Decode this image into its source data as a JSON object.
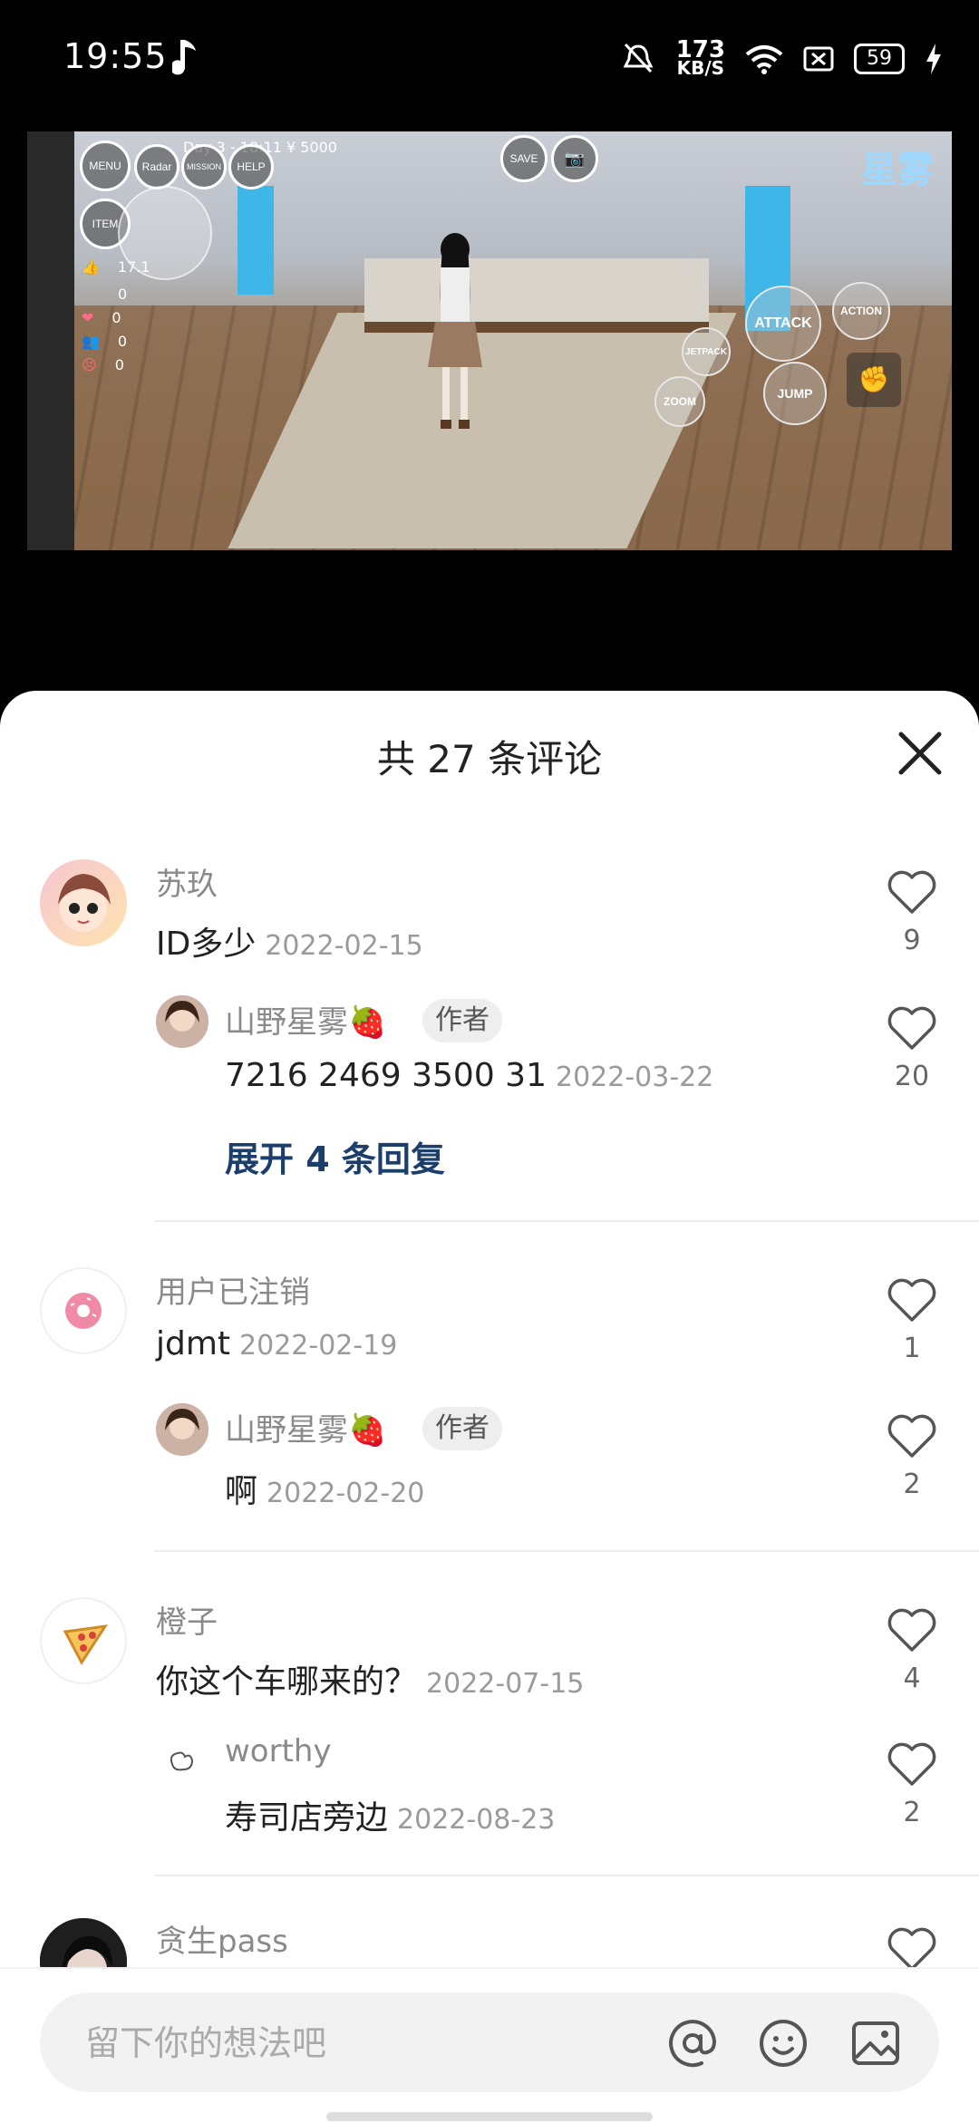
{
  "status": {
    "time": "19:55",
    "net_speed_value": "173",
    "net_speed_unit": "KB/S",
    "battery": "59"
  },
  "video": {
    "hud_info": "Day 3 - 18:11  ¥ 5000",
    "buttons": {
      "menu": "MENU",
      "radar": "Radar",
      "mission": "MISSION",
      "help": "HELP",
      "item": "ITEM",
      "save": "SAVE",
      "attack": "ATTACK",
      "action": "ACTION",
      "jetpack": "JETPACK",
      "jump": "JUMP",
      "zoom": "ZOOM"
    },
    "stats": [
      "17.1",
      "0",
      "0",
      "0",
      "0"
    ],
    "watermark": "星雾"
  },
  "sheet": {
    "title": "共 27 条评论"
  },
  "comments": [
    {
      "user": "苏玖",
      "text": "ID多少",
      "date": "2022-02-15",
      "likes": "9",
      "reply": {
        "user": "山野星雾🍓",
        "badge": "作者",
        "text": "7216 2469 3500 31",
        "date": "2022-03-22",
        "likes": "20"
      },
      "expand": "展开 4 条回复"
    },
    {
      "user": "用户已注销",
      "text": "jdmt",
      "date": "2022-02-19",
      "likes": "1",
      "reply": {
        "user": "山野星雾🍓",
        "badge": "作者",
        "text": "啊",
        "date": "2022-02-20",
        "likes": "2"
      }
    },
    {
      "user": "橙子",
      "text": "你这个车哪来的？",
      "date": "2022-07-15",
      "likes": "4",
      "reply": {
        "user": "worthy",
        "text": "寿司店旁边",
        "date": "2022-08-23",
        "likes": "2"
      }
    },
    {
      "user": "贪生pass"
    }
  ],
  "input": {
    "placeholder": "留下你的想法吧"
  },
  "colors": {
    "accent_link": "#1c3e6b",
    "sheet_bg": "#ffffff",
    "input_bg": "#f2f2f2"
  }
}
